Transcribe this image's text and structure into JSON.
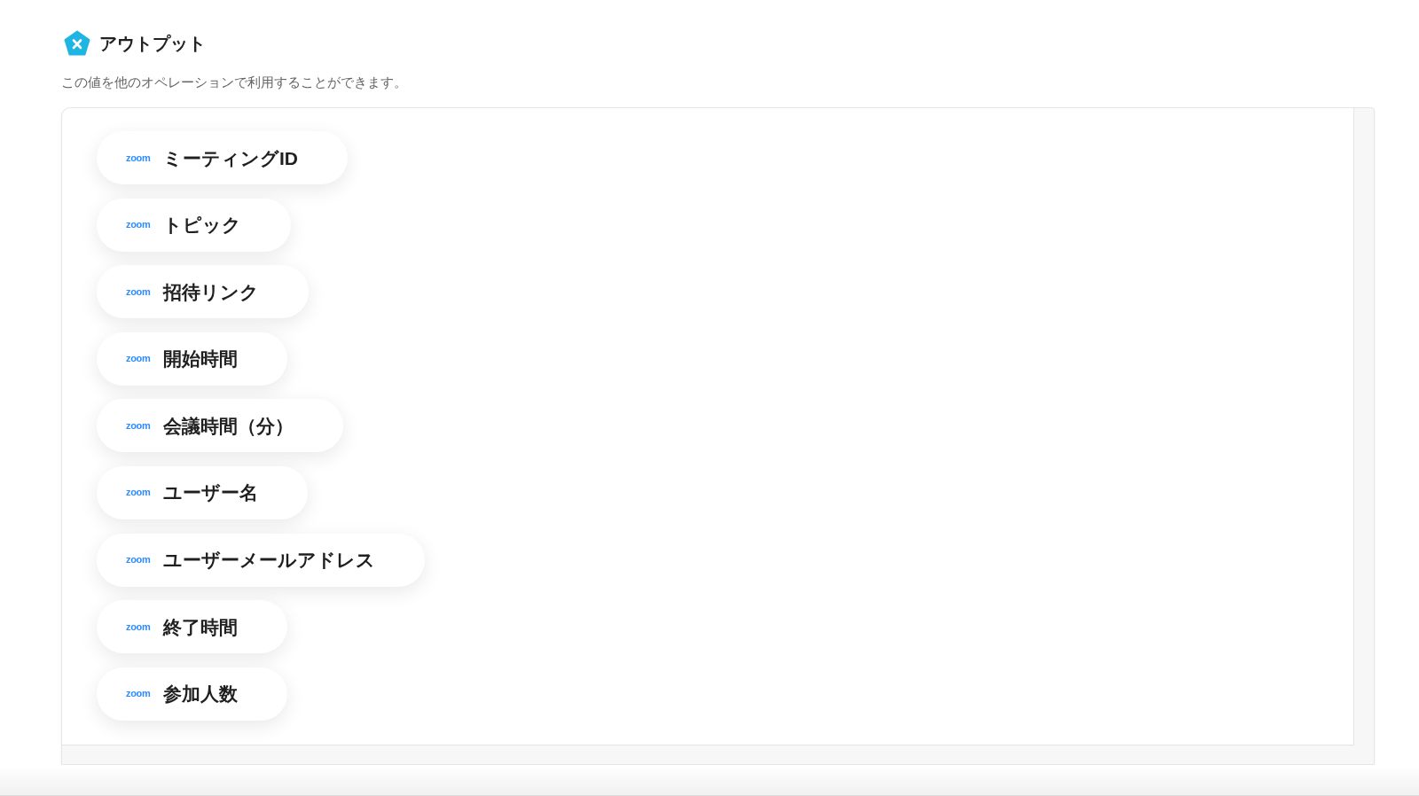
{
  "header": {
    "title": "アウトプット",
    "description": "この値を他のオペレーションで利用することができます。"
  },
  "outputs": [
    {
      "source": "zoom",
      "label": "ミーティングID"
    },
    {
      "source": "zoom",
      "label": "トピック"
    },
    {
      "source": "zoom",
      "label": "招待リンク"
    },
    {
      "source": "zoom",
      "label": "開始時間"
    },
    {
      "source": "zoom",
      "label": "会議時間（分）"
    },
    {
      "source": "zoom",
      "label": "ユーザー名"
    },
    {
      "source": "zoom",
      "label": "ユーザーメールアドレス"
    },
    {
      "source": "zoom",
      "label": "終了時間"
    },
    {
      "source": "zoom",
      "label": "参加人数"
    }
  ]
}
